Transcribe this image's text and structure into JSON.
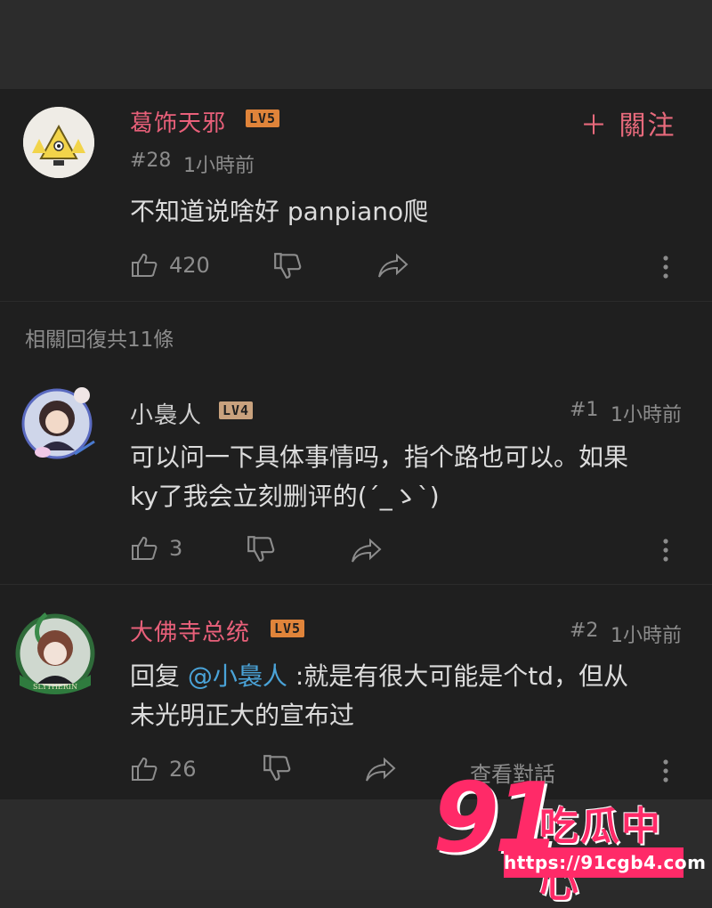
{
  "comment": {
    "username": "葛饰天邪",
    "level": "LV5",
    "follow_label": "＋ 關注",
    "floor": "#28",
    "time": "1小時前",
    "text": "不知道说啥好 panpiano爬",
    "likes": "420",
    "icons": {
      "like": "thumbs-up-icon",
      "dislike": "thumbs-down-icon",
      "share": "share-icon",
      "more": "more-icon"
    }
  },
  "replies_title": "相關回復共11條",
  "replies": [
    {
      "username": "小裊人",
      "level": "LV4",
      "floor": "#1",
      "time": "1小時前",
      "text_line1": "可以问一下具体事情吗，指个路也可以。如果",
      "text_line2": "ky了我会立刻删评的(´_ゝ`)",
      "likes": "3"
    },
    {
      "username": "大佛寺总统",
      "level": "LV5",
      "floor": "#2",
      "time": "1小時前",
      "reply_prefix": "回复 ",
      "mention": "@小裊人",
      "text_rest": " :就是有很大可能是个td，但从",
      "text_line2": "未光明正大的宣布过",
      "likes": "26",
      "view_thread": "查看對話"
    }
  ],
  "watermark": {
    "number": "91",
    "name": "吃瓜中心",
    "url": "https://91cgb4.com"
  },
  "colors": {
    "accent": "#e9607a",
    "mention": "#4aa3d8",
    "panel": "#1f1f1f",
    "watermark": "#ff2a68"
  }
}
